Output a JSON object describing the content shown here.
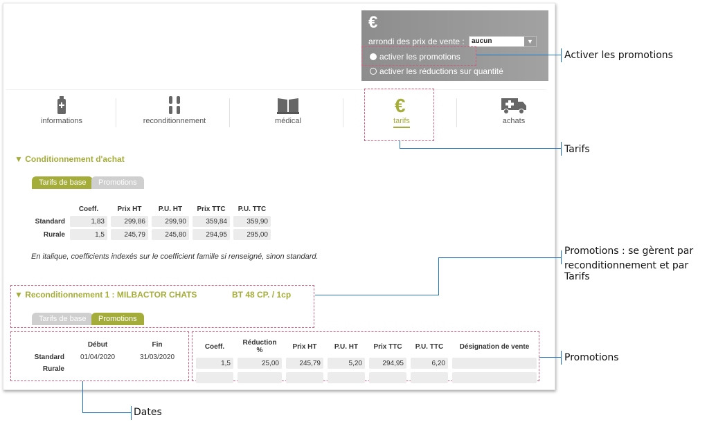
{
  "top_box": {
    "euro_icon": "€",
    "arrondi_label": "arrondi des prix de vente :",
    "arrondi_value": "aucun",
    "radio_promotions": "activer les promotions",
    "radio_reductions": "activer les réductions sur quantité"
  },
  "nav_tabs": [
    {
      "label": "informations",
      "icon": "bottle-plus-icon"
    },
    {
      "label": "reconditionnement",
      "icon": "bottles-icon"
    },
    {
      "label": "médical",
      "icon": "open-book-icon"
    },
    {
      "label": "tarifs",
      "icon": "euro-icon"
    },
    {
      "label": "achats",
      "icon": "ambulance-truck-icon"
    }
  ],
  "conditionnement": {
    "title": "▼ Conditionnement d'achat",
    "tab_base": "Tarifs de base",
    "tab_promo": "Promotions",
    "headers": [
      "Coeff.",
      "Prix HT",
      "P.U. HT",
      "Prix TTC",
      "P.U. TTC"
    ],
    "rows": [
      {
        "label": "Standard",
        "values": [
          "1,83",
          "299,86",
          "299,90",
          "359,84",
          "359,90"
        ]
      },
      {
        "label": "Rurale",
        "values": [
          "1,5",
          "245,79",
          "245,80",
          "294,95",
          "295,00"
        ]
      }
    ],
    "note": "En italique, coefficients indexés sur le coefficient famille si renseigné, sinon standard."
  },
  "reconditionnement": {
    "title": "▼ Reconditionnement 1  :  MILBACTOR CHATS",
    "presentation": "BT 48 CP. / 1cp",
    "tab_base": "Tarifs de base",
    "tab_promo": "Promotions",
    "dates_headers": [
      "Début",
      "Fin"
    ],
    "dates_rows": [
      {
        "label": "Standard",
        "debut": "01/04/2020",
        "fin": "31/03/2020"
      },
      {
        "label": "Rurale",
        "debut": "",
        "fin": ""
      }
    ],
    "promo_headers": [
      "Coeff.",
      "Réduction %",
      "Prix HT",
      "P.U. HT",
      "Prix TTC",
      "P.U. TTC",
      "Désignation de vente"
    ],
    "promo_rows": [
      {
        "values": [
          "1,5",
          "25,00",
          "245,79",
          "5,20",
          "294,95",
          "6,20",
          ""
        ]
      },
      {
        "values": [
          "",
          "",
          "",
          "",
          "",
          "",
          ""
        ]
      }
    ]
  },
  "callouts": {
    "activer_promotions": "Activer les promotions",
    "tarifs": "Tarifs",
    "promotions_gerent_line1": "Promotions : se gèrent par",
    "promotions_gerent_line2": "reconditionnement et par Tarifs",
    "promotions": "Promotions",
    "dates": "Dates"
  },
  "colors": {
    "accent": "#a4ad3a",
    "callout_line": "#1e73be",
    "highlight_border": "#d65a7a"
  }
}
